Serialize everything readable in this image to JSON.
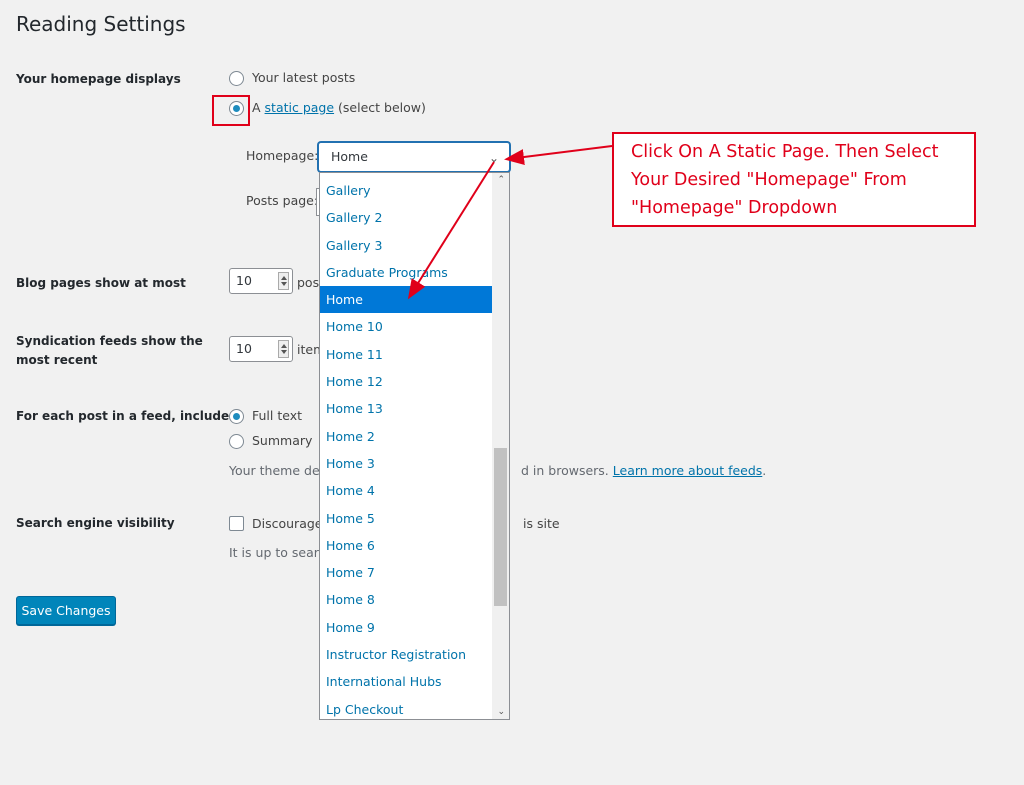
{
  "page_title": "Reading Settings",
  "homepage_displays": {
    "label": "Your homepage displays",
    "option_latest": "Your latest posts",
    "option_static_prefix": "A",
    "option_static_link": "static page",
    "option_static_suffix": "(select below)",
    "selected": "static page"
  },
  "homepage_select": {
    "label": "Homepage:",
    "value": "Home",
    "options": [
      "Gallery",
      "Gallery 2",
      "Gallery 3",
      "Graduate Programs",
      "Home",
      "Home 10",
      "Home 11",
      "Home 12",
      "Home 13",
      "Home 2",
      "Home 3",
      "Home 4",
      "Home 5",
      "Home 6",
      "Home 7",
      "Home 8",
      "Home 9",
      "Instructor Registration",
      "International Hubs",
      "Lp Checkout"
    ],
    "highlighted": "Home"
  },
  "posts_page": {
    "label": "Posts page:"
  },
  "blog_pages": {
    "label": "Blog pages show at most",
    "value": "10",
    "unit": "pos"
  },
  "syndication": {
    "label_line1": "Syndication feeds show the",
    "label_line2": "most recent",
    "value": "10",
    "unit": "item"
  },
  "feed_include": {
    "label": "For each post in a feed, include",
    "option_full": "Full text",
    "option_summary": "Summary",
    "selected": "Full text",
    "desc_start": "Your theme det",
    "desc_end": "d in browsers.",
    "desc_link": "Learn more about feeds",
    "desc_period": "."
  },
  "search_visibility": {
    "label": "Search engine visibility",
    "checkbox_text": "Discourage",
    "checkbox_text_end": "is site",
    "desc": "It is up to searc",
    "checked": false
  },
  "save_button": "Save Changes",
  "callout": {
    "line1": "Click On A Static Page. Then Select",
    "line2": "Your Desired \"Homepage\"  From",
    "line3": "\"Homepage\" Dropdown"
  },
  "colors": {
    "accent": "#0073aa",
    "annotation": "#e0001a",
    "highlight": "#0078d7",
    "button": "#0085ba"
  },
  "icons": {
    "select_arrow": "chevron-down-icon",
    "scroll_up": "scroll-up-icon",
    "scroll_down": "scroll-down-icon"
  }
}
